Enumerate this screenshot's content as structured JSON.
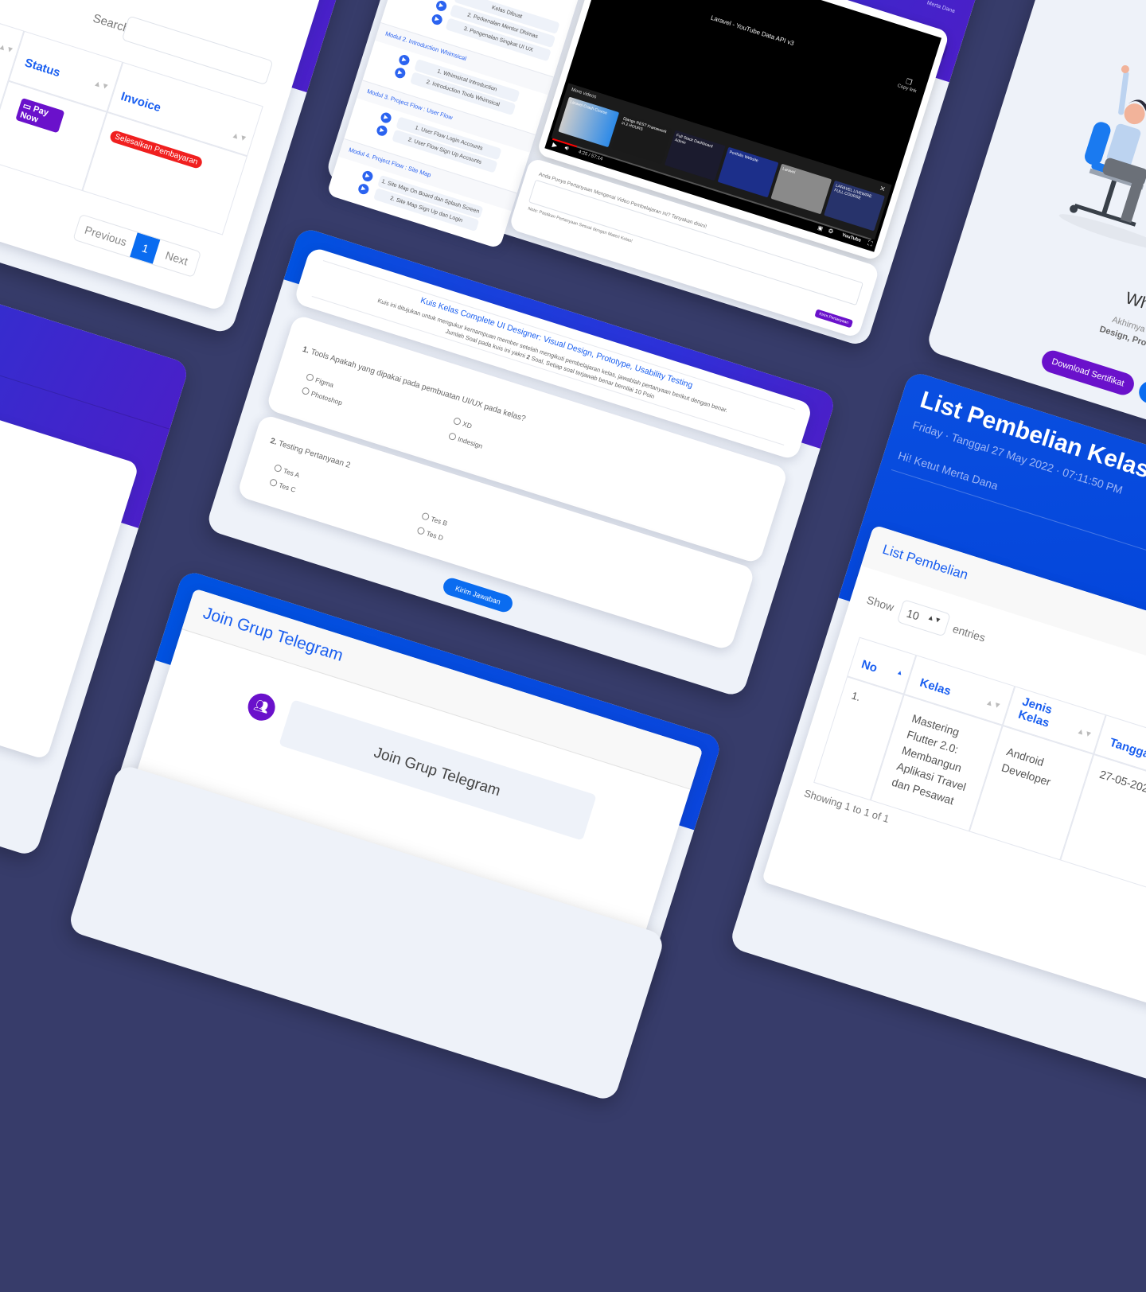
{
  "colors": {
    "background": "#373c6a",
    "primary_blue": "#0052e0",
    "purple": "#6a11cb",
    "danger": "#f01f1f",
    "light": "#eef2f9"
  },
  "invoice_table": {
    "search_label": "Search:",
    "search_value": "",
    "columns": [
      "Status",
      "Invoice"
    ],
    "row": {
      "status_button": "Pay Now",
      "status_icon": "credit-card-icon",
      "invoice_badge": "Selesaikan Pembayaran"
    },
    "pagination": {
      "previous": "Previous",
      "current": "1",
      "next": "Next"
    }
  },
  "curriculum": {
    "modules": [
      {
        "title": "",
        "items": [
          "Kelas Dibuat",
          "2. Perkenalan Mentor Dhimas",
          "3. Pengenalan Singkat UI UX"
        ]
      },
      {
        "title": "Modul 2. Introduction Whimsical",
        "items": [
          "1. Whimsical Introduction",
          "2. Introduction Tools Whimsical"
        ]
      },
      {
        "title": "Modul 3. Project Flow : User Flow",
        "items": [
          "1. User Flow Login Accounts",
          "2. User Flow Sign Up Accounts"
        ]
      },
      {
        "title": "Modul 4. Project Flow : Site Map",
        "items": [
          "1. Site Map On Board dan Splash Screen",
          "2. Site Map Sign Up dan Login"
        ]
      }
    ]
  },
  "video": {
    "header_user": "Merta Dana",
    "title": "Laravel - YouTube Data API v3",
    "copy_link": "Copy link",
    "more_videos": "More videos",
    "time": "4:25 / 57:14",
    "progress_percent": 7.7,
    "youtube_label": "YouTube",
    "thumbnails": [
      "Laravel Crash Course",
      "Django REST Framework in 2 HOURS",
      "Full Stack Dashboard Admin",
      "Portfolio Website",
      "Laravel",
      "LARAVEL LIVEWIRE FULL COURSE"
    ]
  },
  "question_box": {
    "label": "Anda Punya Pertanyaan Mengenai Video Pembelajaran ini? Tanyakan disini!",
    "value": "",
    "note": "Note: Pastikan Pertanyaan Sesuai dengan Materi Kelas!",
    "button": "Kirim Pertanyaan"
  },
  "quiz": {
    "title": "Kuis Kelas Complete UI Designer: Visual Design, Prototype, Usability Testing",
    "description": "Kuis ini ditujukan untuk mengukur kemampuan member setelah mengikuti pembelajaran kelas, jawablah pertanyaan berikut dengan benar.",
    "count_line_prefix": "Jumlah Soal pada kuis ini yakni",
    "count": "2",
    "count_line_suffix": "Soal, Setiap soal terjawab benar bernilai 10 Poin",
    "questions": [
      {
        "number": "1.",
        "text": "Tools Apakah yang dipakai pada pembuatan UI/UX pada kelas?",
        "options": [
          "Figma",
          "XD",
          "Photoshop",
          "Indesign"
        ]
      },
      {
        "number": "2.",
        "text": "Testing Pertanyaan 2",
        "options": [
          "Tes A",
          "Tes B",
          "Tes C",
          "Tes D"
        ]
      }
    ],
    "submit": "Kirim Jawaban"
  },
  "telegram": {
    "header": "Join Grup Telegram",
    "icon": "users-icon",
    "button": "Join Grup Telegram"
  },
  "certificate": {
    "title": "What a Day! Sco",
    "text_line1": "Akhirnya anda telah menyelesaikan",
    "text_line2_bold": "Design, Prototype, Usability Testing",
    "text_line2_rest": " d",
    "download_button": "Download Sertifikat"
  },
  "purchases": {
    "title": "List Pembelian Kelas S",
    "date_line": "Friday · Tanggal 27 May 2022 · 07:11:50 PM",
    "greeting": "Hi! Ketut Merta Dana",
    "card_title": "List Pembelian",
    "show_label": "Show",
    "entries_value": "10",
    "entries_label": "entries",
    "columns": [
      "No",
      "Kelas",
      "Jenis Kelas",
      "Tanggal"
    ],
    "rows": [
      {
        "no": "1.",
        "kelas": "Mastering Flutter 2.0: Membangun Aplikasi Travel dan Pesawat",
        "jenis": "Android Developer",
        "tanggal": "27-05-202"
      }
    ],
    "showing": "Showing 1 to 1 of 1"
  }
}
